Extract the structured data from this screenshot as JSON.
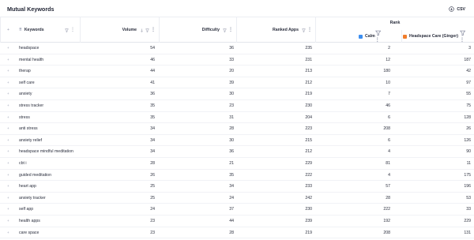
{
  "header": {
    "title": "Mutual Keywords",
    "export_label": "CSV"
  },
  "columns": {
    "keywords": "Keywords",
    "volume": "Volume",
    "difficulty": "Difficulty",
    "ranked_apps": "Ranked Apps",
    "rank": "Rank",
    "calm": "Calm",
    "headspace": "Headspace Care (Ginger)"
  },
  "colors": {
    "calm": "#3d8ff0",
    "headspace": "#f07d2c"
  },
  "rows": [
    {
      "keyword": "headspace",
      "volume": "54",
      "difficulty": "36",
      "ranked_apps": "235",
      "calm": "2",
      "headspace": "3"
    },
    {
      "keyword": "mental health",
      "volume": "46",
      "difficulty": "33",
      "ranked_apps": "231",
      "calm": "12",
      "headspace": "187"
    },
    {
      "keyword": "therap",
      "volume": "44",
      "difficulty": "20",
      "ranked_apps": "213",
      "calm": "180",
      "headspace": "42"
    },
    {
      "keyword": "self care",
      "volume": "41",
      "difficulty": "39",
      "ranked_apps": "212",
      "calm": "10",
      "headspace": "97"
    },
    {
      "keyword": "anxiety",
      "volume": "36",
      "difficulty": "30",
      "ranked_apps": "219",
      "calm": "7",
      "headspace": "55"
    },
    {
      "keyword": "stress tracker",
      "volume": "35",
      "difficulty": "23",
      "ranked_apps": "230",
      "calm": "46",
      "headspace": "75"
    },
    {
      "keyword": "stress",
      "volume": "35",
      "difficulty": "31",
      "ranked_apps": "204",
      "calm": "6",
      "headspace": "128"
    },
    {
      "keyword": "anti stress",
      "volume": "34",
      "difficulty": "28",
      "ranked_apps": "223",
      "calm": "208",
      "headspace": "26"
    },
    {
      "keyword": "anxiety relief",
      "volume": "34",
      "difficulty": "30",
      "ranked_apps": "215",
      "calm": "6",
      "headspace": "126"
    },
    {
      "keyword": "headspace mindful meditation",
      "volume": "34",
      "difficulty": "36",
      "ranked_apps": "212",
      "calm": "4",
      "headspace": "90"
    },
    {
      "keyword": "cbt i",
      "volume": "28",
      "difficulty": "21",
      "ranked_apps": "229",
      "calm": "81",
      "headspace": "11"
    },
    {
      "keyword": "guided meditation",
      "volume": "26",
      "difficulty": "35",
      "ranked_apps": "222",
      "calm": "4",
      "headspace": "175"
    },
    {
      "keyword": "heart app",
      "volume": "25",
      "difficulty": "34",
      "ranked_apps": "233",
      "calm": "57",
      "headspace": "196"
    },
    {
      "keyword": "anxiety tracker",
      "volume": "25",
      "difficulty": "24",
      "ranked_apps": "242",
      "calm": "28",
      "headspace": "53"
    },
    {
      "keyword": "self app",
      "volume": "24",
      "difficulty": "37",
      "ranked_apps": "230",
      "calm": "222",
      "headspace": "33"
    },
    {
      "keyword": "health apps",
      "volume": "23",
      "difficulty": "44",
      "ranked_apps": "239",
      "calm": "192",
      "headspace": "229"
    },
    {
      "keyword": "care space",
      "volume": "23",
      "difficulty": "28",
      "ranked_apps": "219",
      "calm": "208",
      "headspace": "131"
    }
  ]
}
